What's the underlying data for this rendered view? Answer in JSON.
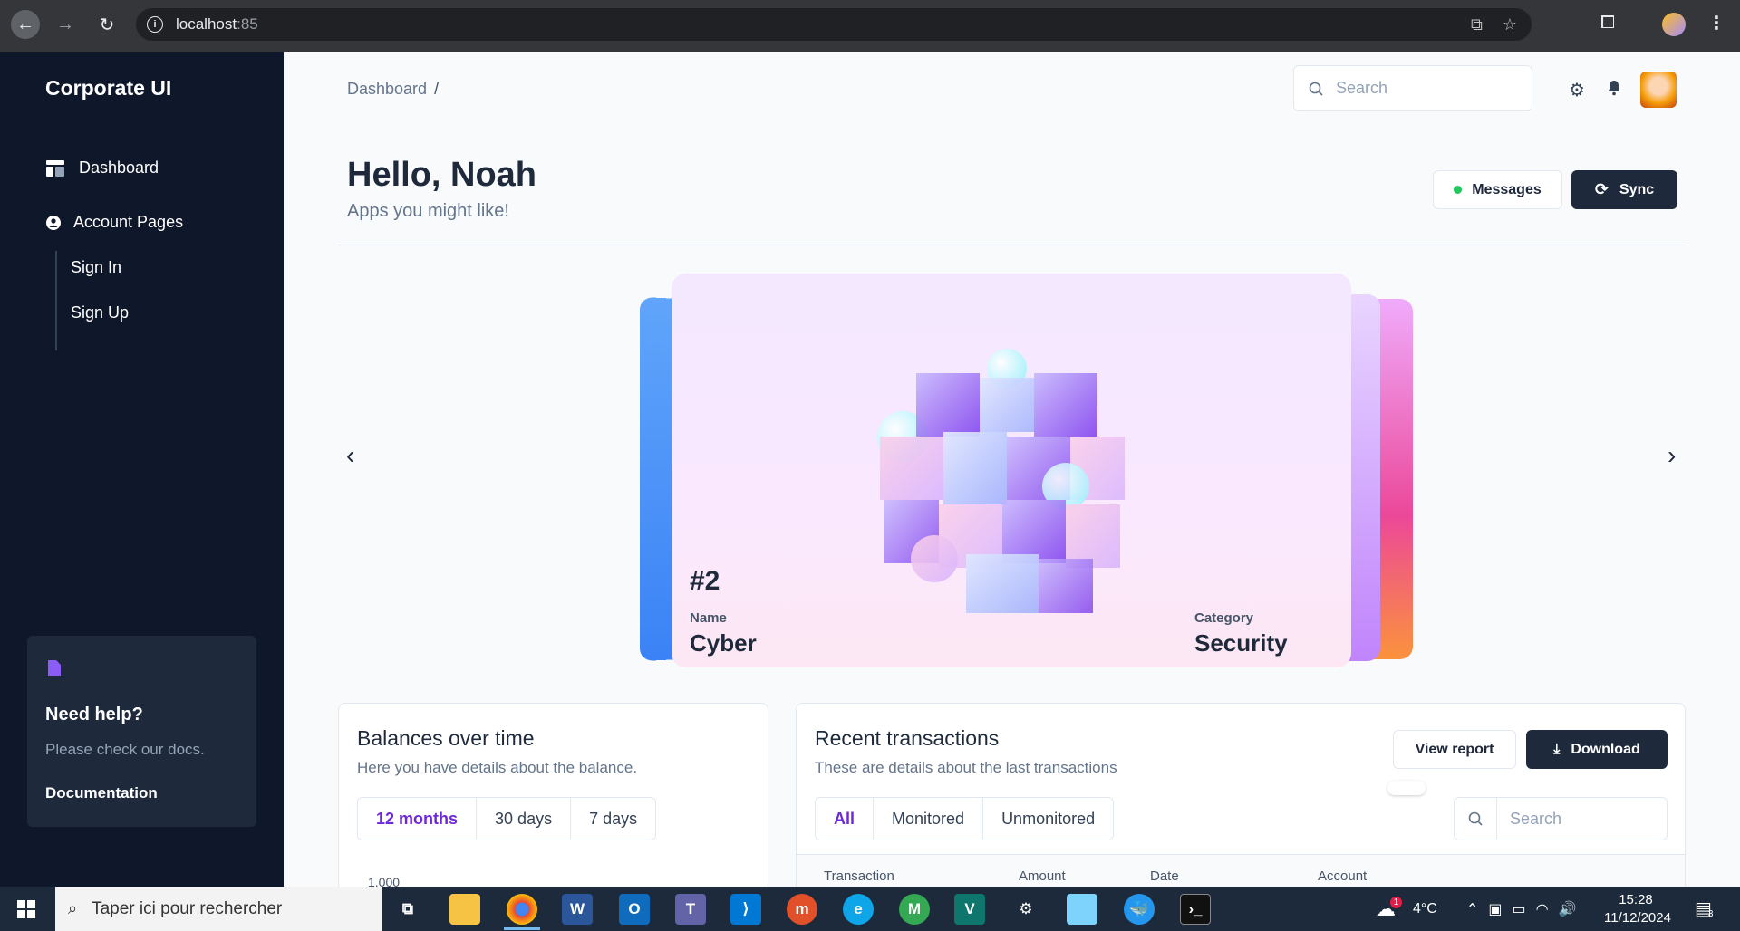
{
  "browser": {
    "url_host": "localhost",
    "url_port": ":85"
  },
  "sidebar": {
    "brand": "Corporate UI",
    "items": [
      {
        "label": "Dashboard",
        "icon": "dashboard-icon"
      },
      {
        "label": "Account Pages",
        "icon": "user-circle-icon"
      }
    ],
    "sub_items": [
      "Sign In",
      "Sign Up"
    ],
    "help": {
      "title": "Need help?",
      "subtitle": "Please check our docs.",
      "link": "Documentation"
    }
  },
  "header": {
    "breadcrumb": "Dashboard",
    "breadcrumb_sep": "/",
    "search_placeholder": "Search"
  },
  "hero": {
    "greeting": "Hello, Noah",
    "subtitle": "Apps you might like!",
    "messages_label": "Messages",
    "sync_label": "Sync"
  },
  "carousel": {
    "rank": "#2",
    "name_label": "Name",
    "name_value": "Cyber",
    "category_label": "Category",
    "category_value": "Security"
  },
  "balances": {
    "title": "Balances over time",
    "subtitle": "Here you have details about the balance.",
    "ranges": [
      "12 months",
      "30 days",
      "7 days"
    ],
    "active_range": "12 months",
    "y_tick_top": "1,000"
  },
  "transactions": {
    "title": "Recent transactions",
    "subtitle": "These are details about the last transactions",
    "view_report_label": "View report",
    "download_label": "Download",
    "filters": [
      "All",
      "Monitored",
      "Unmonitored"
    ],
    "active_filter": "All",
    "search_placeholder": "Search",
    "columns": [
      "Transaction",
      "Amount",
      "Date",
      "Account"
    ]
  },
  "taskbar": {
    "search_placeholder": "Taper ici pour rechercher",
    "temperature": "4°C",
    "weather_badge": "1",
    "time": "15:28",
    "date": "11/12/2024",
    "notification_count": "3"
  },
  "colors": {
    "sidebar_bg": "#0f172a",
    "accent_purple": "#6d28d9",
    "primary_dark": "#1e293b",
    "status_green": "#22c55e"
  }
}
